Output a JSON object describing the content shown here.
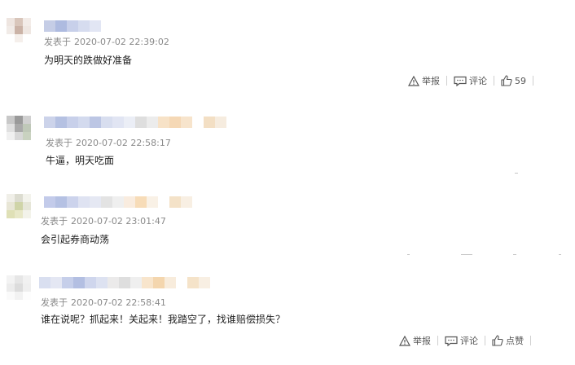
{
  "comments": [
    {
      "posted_prefix": "发表于",
      "timestamp": "2020-07-02 22:39:02",
      "text": "为明天的跌做好准备",
      "actions": {
        "report": "举报",
        "comment": "评论",
        "like": "59"
      }
    },
    {
      "posted_prefix": "发表于",
      "timestamp": "2020-07-02 22:58:17",
      "text": "牛逼，明天吃面"
    },
    {
      "posted_prefix": "发表于",
      "timestamp": "2020-07-02 23:01:47",
      "text": "会引起券商动荡"
    },
    {
      "posted_prefix": "发表于",
      "timestamp": "2020-07-02 22:58:41",
      "text": "谁在说呢？抓起来！关起来！我踏空了，找谁赔偿损失？",
      "actions": {
        "report": "举报",
        "comment": "评论",
        "like": "点赞"
      }
    }
  ],
  "colors": {
    "meta_text": "#8a8a8a",
    "body_text": "#222222",
    "action_text": "#555555"
  },
  "icons": [
    "warning-icon",
    "comment-icon",
    "thumbs-up-icon"
  ]
}
